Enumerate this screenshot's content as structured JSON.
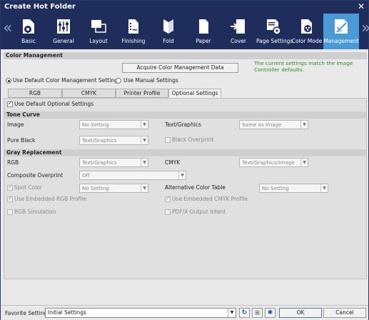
{
  "window": {
    "title": "Create Hot Folder",
    "close_glyph": "✕"
  },
  "nav": {
    "prev_glyph": "«",
    "next_glyph": "»",
    "items": [
      {
        "label": "Basic",
        "icon": "gear-folder-icon"
      },
      {
        "label": "General",
        "icon": "sliders-icon"
      },
      {
        "label": "Layout",
        "icon": "layout-icon"
      },
      {
        "label": "Finishing",
        "icon": "finishing-icon"
      },
      {
        "label": "Fold",
        "icon": "fold-icon"
      },
      {
        "label": "Paper",
        "icon": "paper-icon"
      },
      {
        "label": "Cover",
        "icon": "cover-icon"
      },
      {
        "label": "Page Settings",
        "icon": "page-settings-icon"
      },
      {
        "label": "Color Mode",
        "icon": "color-mode-icon"
      },
      {
        "label": "Management",
        "icon": "management-icon",
        "active": true
      }
    ]
  },
  "color_management": {
    "header": "Color Management",
    "acquire_button": "Acquire Color Management Data",
    "note_line1": "The current settings match the Image",
    "note_line2": "Controller defaults.",
    "radio_default": "Use Default Color Management Settings",
    "radio_manual": "Use Manual Settings",
    "selected_radio": "default"
  },
  "tabs": [
    "RGB",
    "CMYK",
    "Printer Profile",
    "Optional Settings"
  ],
  "active_tab": "Optional Settings",
  "optional": {
    "use_default_label": "Use Default Optional Settings",
    "use_default_checked": true,
    "tone_curve": {
      "header": "Tone Curve",
      "image_label": "Image",
      "image_value": "No Setting",
      "text_graphics_label": "Text/Graphics",
      "text_graphics_value": "Same as Image",
      "pure_black_label": "Pure Black",
      "pure_black_value": "Text/Graphics",
      "black_overprint_label": "Black Overprint"
    },
    "gray_replacement": {
      "header": "Gray Replacement",
      "rgb_label": "RGB",
      "rgb_value": "Text/Graphics",
      "cmyk_label": "CMYK",
      "cmyk_value": "Text/Graphics/Image"
    },
    "composite_overprint_label": "Composite Overprint",
    "composite_overprint_value": "Off",
    "spot_color_label": "Spot Color",
    "spot_color_value": "No Setting",
    "alt_color_table_label": "Alternative Color Table",
    "alt_color_table_value": "No Setting",
    "embedded_rgb_label": "Use Embedded RGB Profile",
    "embedded_cmyk_label": "Use Embedded CMYK Profile",
    "rgb_simulation_label": "RGB Simulation",
    "pdfx_label": "PDF/X Output Intent"
  },
  "footer": {
    "favorite_label": "Favorite Setting",
    "favorite_value": "Initial Settings",
    "refresh_glyph": "↻",
    "save_glyph": "▣",
    "star_glyph": "✱",
    "ok_label": "OK",
    "cancel_label": "Cancel"
  },
  "colors": {
    "titlebar": "#1f2d5c",
    "active_tab": "#4a9ad8",
    "note": "#2e8a2e"
  }
}
